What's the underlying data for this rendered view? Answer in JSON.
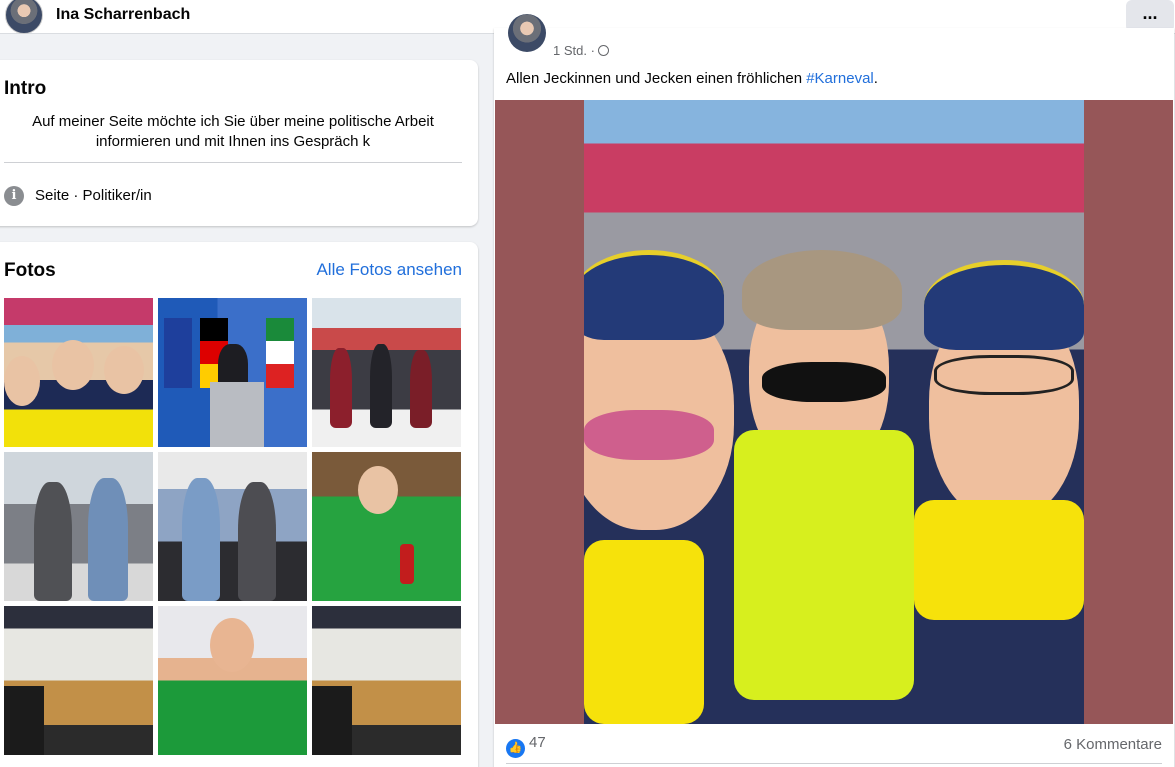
{
  "header": {
    "profile_name": "Ina Scharrenbach",
    "more_label": "..."
  },
  "intro": {
    "title": "Intro",
    "bio": "Auf meiner Seite möchte ich Sie über meine politische Arbeit informieren und mit Ihnen ins Gespräch k",
    "category": "Seite · Politiker/in",
    "info_icon": "i"
  },
  "photos": {
    "title": "Fotos",
    "see_all": "Alle Fotos ansehen",
    "items": [
      {
        "name": "carnival-selfie-thumb"
      },
      {
        "name": "flags-podium-thumb"
      },
      {
        "name": "carnival-group-thumb"
      },
      {
        "name": "two-women-window-thumb"
      },
      {
        "name": "two-women-walking-thumb"
      },
      {
        "name": "green-suit-interview-thumb"
      },
      {
        "name": "press-conference-thumb"
      },
      {
        "name": "green-suit-smiling-thumb"
      },
      {
        "name": "press-conference-2-thumb"
      }
    ]
  },
  "post": {
    "time": "1 Std. ·",
    "text_prefix": "Allen Jeckinnen und Jecken einen fröhlichen ",
    "hashtag": "#Karneval",
    "text_suffix": ".",
    "likes": "47",
    "like_icon": "👍",
    "comments": "6 Kommentare"
  }
}
